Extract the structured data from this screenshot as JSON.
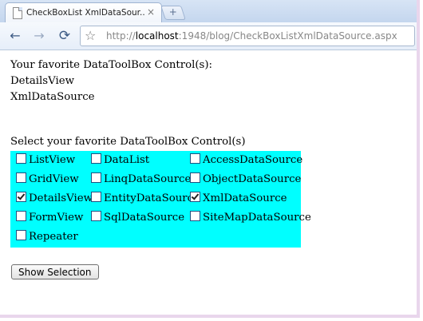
{
  "browser": {
    "tab_title": "CheckBoxList XmlDataSour...",
    "tab_close": "×",
    "new_tab": "+",
    "url_prefix": "http://",
    "url_host": "localhost",
    "url_rest": ":1948/blog/CheckBoxListXmlDataSource.aspx"
  },
  "page": {
    "favorite_heading": "Your favorite DataToolBox Control(s):",
    "selected_lines": [
      "DetailsView",
      "XmlDataSource"
    ],
    "select_heading": "Select your favorite DataToolBox Control(s)",
    "checkboxes": [
      {
        "label": "ListView",
        "checked": false
      },
      {
        "label": "DataList",
        "checked": false
      },
      {
        "label": "AccessDataSource",
        "checked": false
      },
      {
        "label": "GridView",
        "checked": false
      },
      {
        "label": "LinqDataSource",
        "checked": false
      },
      {
        "label": "ObjectDataSource",
        "checked": false
      },
      {
        "label": "DetailsView",
        "checked": true
      },
      {
        "label": "EntityDataSource",
        "checked": false
      },
      {
        "label": "XmlDataSource",
        "checked": true
      },
      {
        "label": "FormView",
        "checked": false
      },
      {
        "label": "SqlDataSource",
        "checked": false
      },
      {
        "label": "SiteMapDataSource",
        "checked": false
      },
      {
        "label": "Repeater",
        "checked": false
      }
    ],
    "button_label": "Show Selection",
    "checkbox_bg": "#00ffff"
  }
}
